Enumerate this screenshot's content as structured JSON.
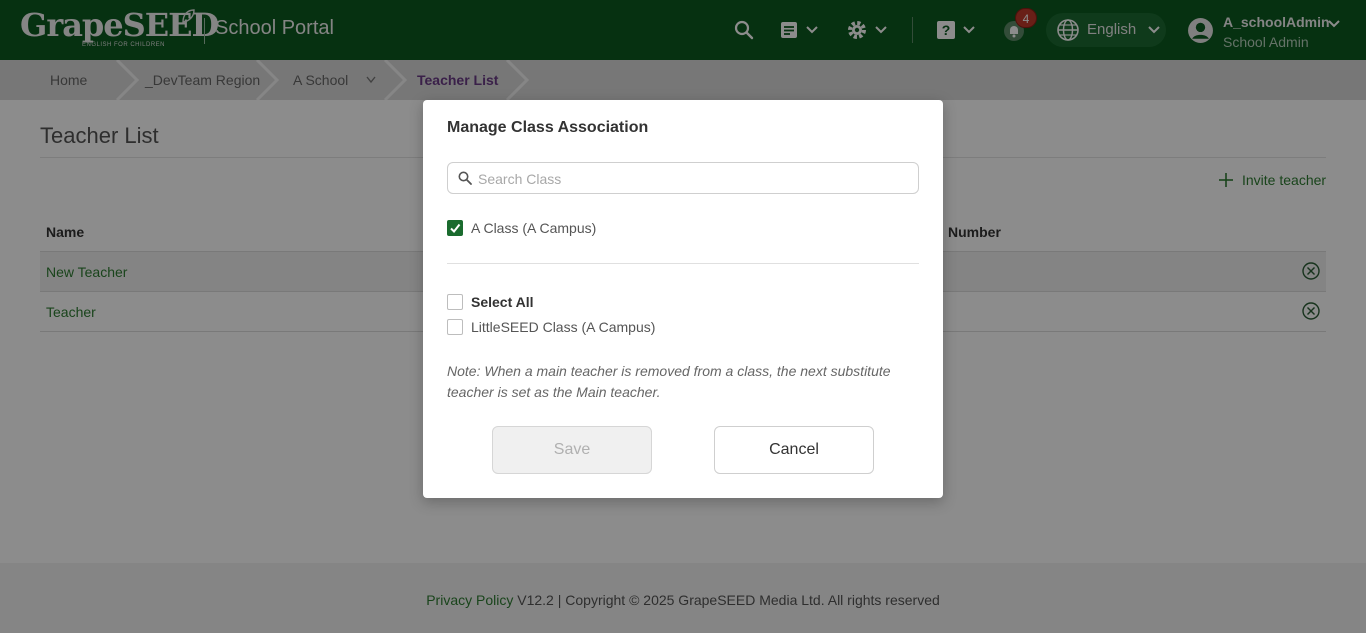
{
  "header": {
    "logo_text": "GrapeSEED",
    "logo_tagline": "ENGLISH FOR CHILDREN",
    "portal_title": "School Portal",
    "notification_count": "4",
    "language": "English",
    "user_name": "A_schoolAdmin",
    "user_role": "School Admin",
    "brand_color": "#0b5a1f"
  },
  "breadcrumb": {
    "items": [
      "Home",
      "_DevTeam Region",
      "A School",
      "Teacher List"
    ]
  },
  "page": {
    "title": "Teacher List",
    "invite_label": "Invite teacher",
    "columns": [
      "Name",
      "Number"
    ],
    "rows": [
      {
        "name": "New Teacher"
      },
      {
        "name": "Teacher"
      }
    ]
  },
  "footer": {
    "privacy": "Privacy Policy",
    "version": "V12.2 |",
    "copyright": "Copyright © 2025 GrapeSEED Media Ltd. All rights reserved"
  },
  "modal": {
    "title": "Manage Class Association",
    "search_placeholder": "Search Class",
    "selected_classes": [
      "A Class (A Campus)"
    ],
    "select_all_label": "Select All",
    "available_classes": [
      "LittleSEED Class (A Campus)"
    ],
    "note": "Note: When a main teacher is removed from a class, the next substitute teacher is set as the Main teacher.",
    "save_label": "Save",
    "cancel_label": "Cancel"
  }
}
